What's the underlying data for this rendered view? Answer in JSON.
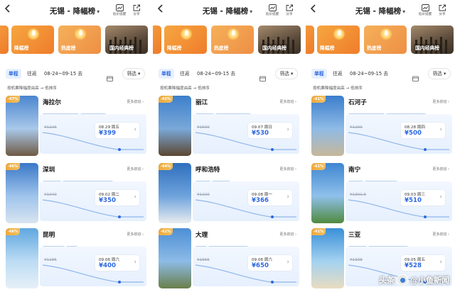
{
  "header": {
    "back_icon": "chevron-left-icon",
    "title": "无锡 - 降幅榜",
    "title_chevron": "▾",
    "alert_label": "低价提醒",
    "share_label": "分享"
  },
  "categories": {
    "favorite": "降幅榜",
    "hot": "热度榜",
    "classic": "国内经典榜"
  },
  "filters": {
    "oneway": "单程",
    "roundtrip": "往返",
    "dates": "08-24~09-15 去",
    "filter_btn": "筛选 ▾"
  },
  "sort_text": "按机票降幅度由高 → 低排序",
  "more_label": "更多航班 ›",
  "colors": {
    "accent": "#2c68e0",
    "orange": "#f08a30",
    "rank_gold": "#f0b040"
  },
  "panels": [
    {
      "cards": [
        {
          "rank": "-67%",
          "city": "海拉尔",
          "tags": [
            "海拉尔国家森林公园",
            "呼伦贝尔古城"
          ],
          "old_price": "¥1226",
          "date": "08.29 周五",
          "price": "¥399",
          "img": [
            "#4a86cf",
            "#a9c8ea",
            "#6f5a44"
          ]
        },
        {
          "rank": "-66%",
          "city": "深圳",
          "tags": [
            "世界之窗",
            "深圳平安金融中心云际观光层"
          ],
          "old_price": "¥1040",
          "date": "09.02 周二",
          "price": "¥350",
          "img": [
            "#3a78c8",
            "#9fc4ec",
            "#d8e4f0"
          ]
        },
        {
          "rank": "-66%",
          "city": "昆明",
          "tags": [
            "石林风景区",
            "滇池"
          ],
          "old_price": "¥1185",
          "date": "09.06 周六",
          "price": "¥400",
          "img": [
            "#5fa7e0",
            "#bcdcf4",
            "#e6f0f8"
          ]
        }
      ]
    },
    {
      "cards": [
        {
          "rank": "-65%",
          "city": "丽江",
          "tags": [
            "玉龙雪山",
            "虎跳峡(香格里拉段)"
          ],
          "old_price": "¥1500",
          "date": "09.07 周日",
          "price": "¥530",
          "img": [
            "#3d7fcc",
            "#7aa8d8",
            "#5c4632"
          ]
        },
        {
          "rank": "-64%",
          "city": "呼和浩特",
          "tags": [
            "大召寺",
            "千古马颂"
          ],
          "old_price": "¥1020",
          "date": "09.08 周一",
          "price": "¥366",
          "img": [
            "#2f6fbe",
            "#6ea3dc",
            "#e9ecef"
          ]
        },
        {
          "rank": "-61%",
          "city": "大理",
          "tags": [
            "苍山",
            "崇圣寺三塔文化旅游区"
          ],
          "old_price": "¥1665",
          "date": "09.06 周六",
          "price": "¥650",
          "img": [
            "#4d8fd6",
            "#8dbbe6",
            "#6a7f4a"
          ]
        }
      ]
    },
    {
      "cards": [
        {
          "rank": "-61%",
          "city": "石河子",
          "tags": [
            "新疆兵团军垦博物馆",
            "新疆张裕巴保男爵酒庄"
          ],
          "old_price": "¥1290",
          "date": "08.28 周四",
          "price": "¥500",
          "img": [
            "#3b7dcc",
            "#8fbbe6",
            "#c7b79a"
          ]
        },
        {
          "rank": "-61%",
          "city": "南宁",
          "tags": [
            "青秀山",
            "南宁方特东盟神画"
          ],
          "old_price": "¥1301.5",
          "date": "09.03 周三",
          "price": "¥510",
          "img": [
            "#3f86d2",
            "#8fc0ea",
            "#4f8a3e"
          ]
        },
        {
          "rank": "-61%",
          "city": "三亚",
          "tags": [
            "蜈支洲岛",
            "三亚亚特兰蒂斯水世界"
          ],
          "old_price": "¥1338",
          "date": "09.05 周五",
          "price": "¥528",
          "img": [
            "#3a8fd8",
            "#a4d2f0",
            "#e8dcc0"
          ]
        }
      ]
    }
  ],
  "watermark": {
    "text_left": "头条",
    "at": "@",
    "text_right": "小鱼新闻"
  }
}
